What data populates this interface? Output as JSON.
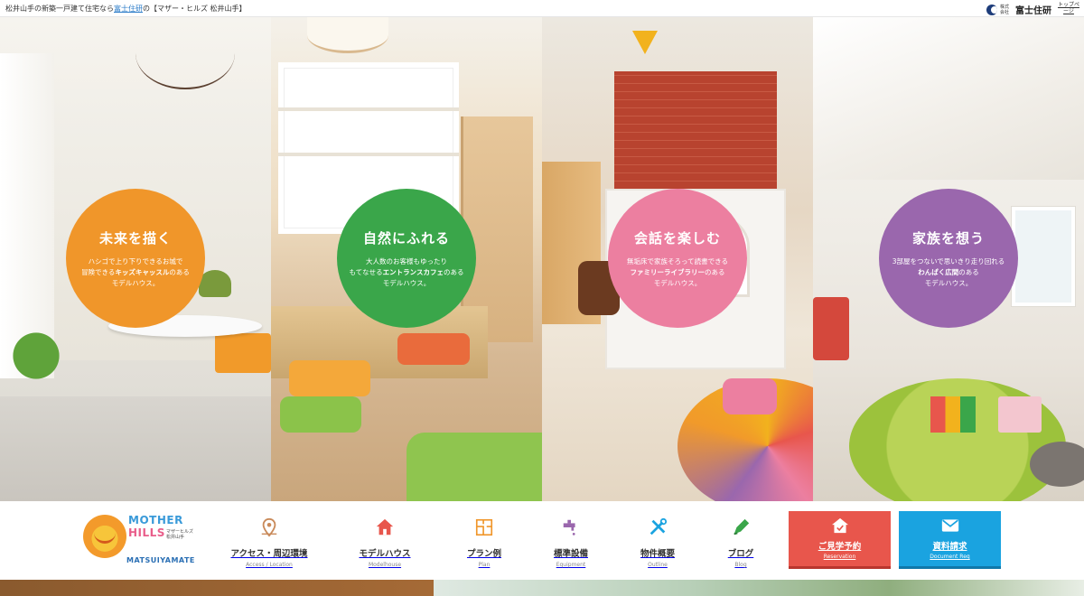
{
  "topbar": {
    "lead_before": "松井山手の新築一戸建て住宅なら",
    "lead_link": "富士住研",
    "lead_after": "の【マザー・ヒルズ 松井山手】",
    "brand_small": "株式会社",
    "brand_name": "富士住研",
    "top_link": "トップページ"
  },
  "panels": [
    {
      "title": "未来を描く",
      "line1": "ハシゴで上り下りできるお城で",
      "line2_pre": "冒険できる",
      "line2_bold": "キッズキャッスル",
      "line2_post": "のある",
      "line3": "モデルハウス。",
      "color": "#f0962a"
    },
    {
      "title": "自然にふれる",
      "line1": "大人数のお客様もゆったり",
      "line2_pre": "もてなせる",
      "line2_bold": "エントランスカフェ",
      "line2_post": "のある",
      "line3": "モデルハウス。",
      "color": "#3aa64a"
    },
    {
      "title": "会話を楽しむ",
      "line1": "無垢床で家族そろって読書できる",
      "line2_pre": "",
      "line2_bold": "ファミリーライブラリー",
      "line2_post": "のある",
      "line3": "モデルハウス。",
      "color": "#ec7fa0"
    },
    {
      "title": "家族を想う",
      "line1": "3部屋をつないで思いきり走り回れる",
      "line2_pre": "",
      "line2_bold": "わんぱく広間",
      "line2_post": "のある",
      "line3": "モデルハウス。",
      "color": "#9a67ad"
    }
  ],
  "logo": {
    "word1": "MOTHER",
    "word2": "HILLS",
    "sub1": "マザーヒルズ",
    "sub2": "松井山手",
    "city": "MATSUIYAMATE"
  },
  "nav": [
    {
      "label": "アクセス・周辺環境",
      "sub": "Access / Location",
      "icon": "map-pin-icon",
      "color": "#c98a5a"
    },
    {
      "label": "モデルハウス",
      "sub": "Modelhouse",
      "icon": "house-icon",
      "color": "#e8564c"
    },
    {
      "label": "プラン例",
      "sub": "Plan",
      "icon": "floor-plan-icon",
      "color": "#f0962a"
    },
    {
      "label": "標準設備",
      "sub": "Equipment",
      "icon": "faucet-icon",
      "color": "#9a67ad"
    },
    {
      "label": "物件概要",
      "sub": "Outline",
      "icon": "tools-icon",
      "color": "#1aa3e0"
    },
    {
      "label": "ブログ",
      "sub": "Blog",
      "icon": "pen-icon",
      "color": "#3aa64a"
    }
  ],
  "cta": {
    "reserve_label": "ご見学予約",
    "reserve_sub": "Reservation",
    "doc_label": "資料請求",
    "doc_sub": "Document Req"
  }
}
